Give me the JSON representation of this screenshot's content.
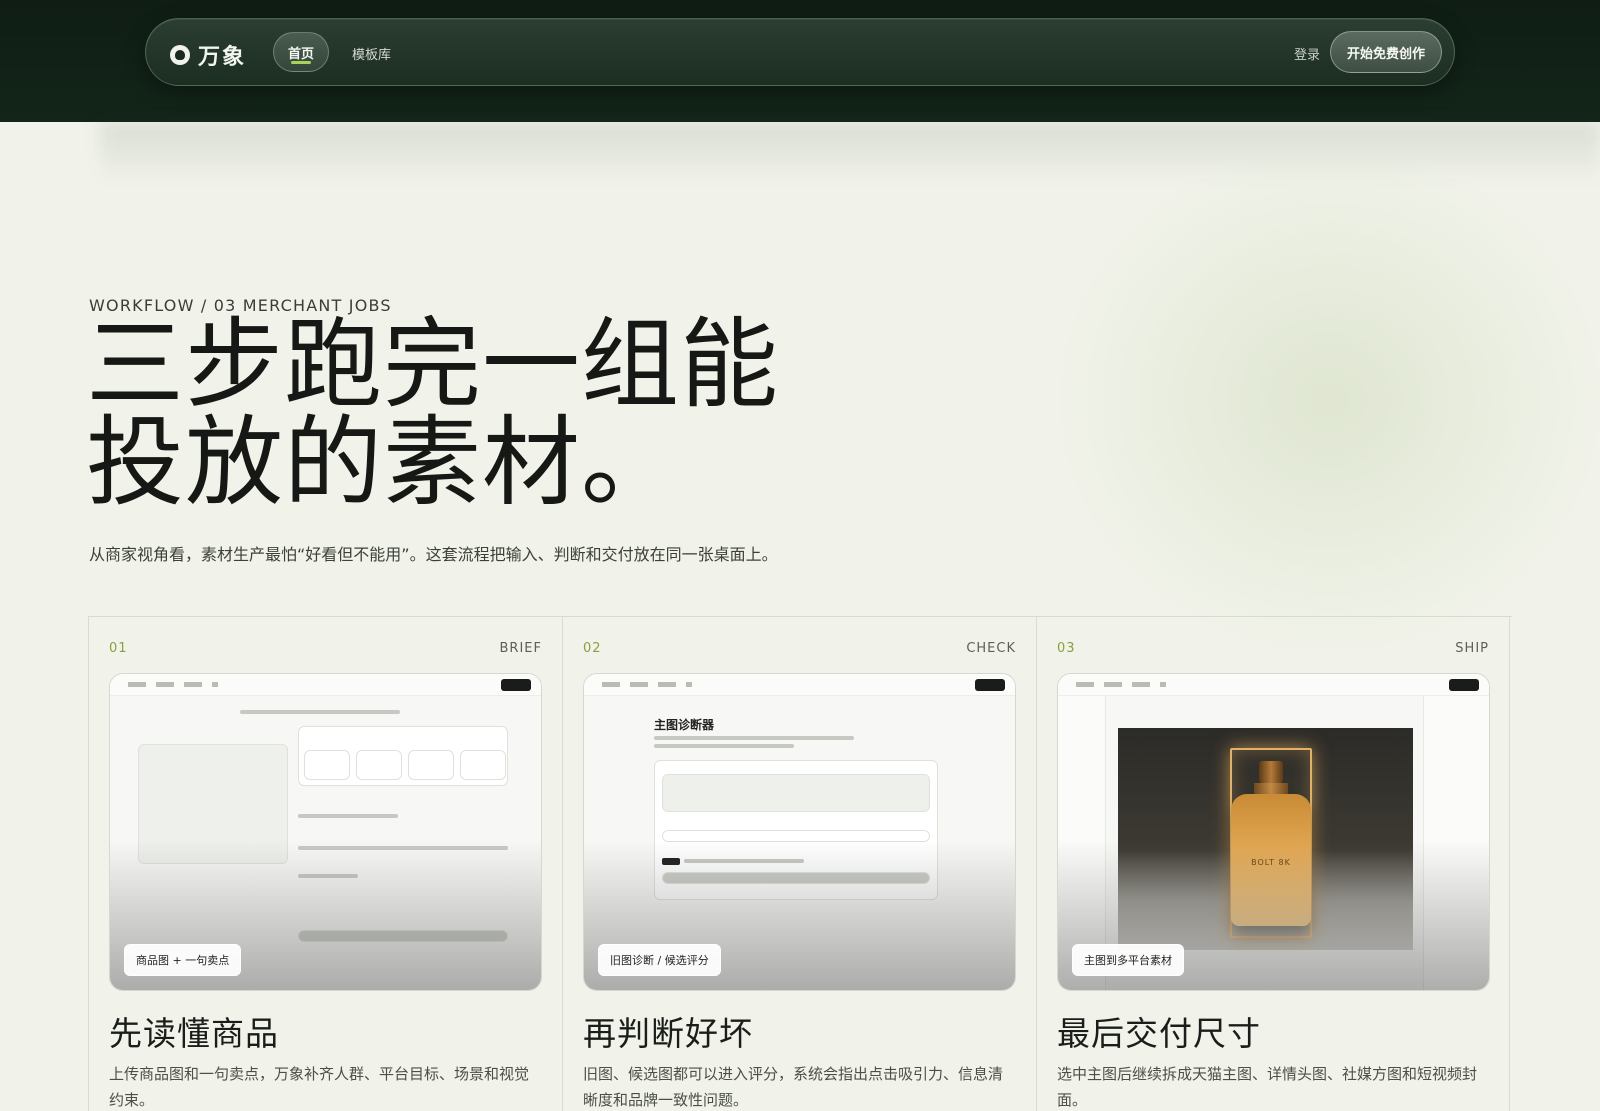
{
  "nav": {
    "logo_text": "万象",
    "home_label": "首页",
    "templates_label": "模板库",
    "login_label": "登录",
    "cta_label": "开始免费创作"
  },
  "hero": {
    "eyebrow": "WORKFLOW / 03 MERCHANT JOBS",
    "headline_line1": "三步跑完一组能",
    "headline_line2": "投放的素材。",
    "subtitle": "从商家视角看，素材生产最怕“好看但不能用”。这套流程把输入、判断和交付放在同一张桌面上。"
  },
  "cards": [
    {
      "num": "01",
      "tag": "BRIEF",
      "badge": "商品图 + 一句卖点",
      "title": "先读懂商品",
      "desc": "上传商品图和一句卖点，万象补齐人群、平台目标、场景和视觉约束。"
    },
    {
      "num": "02",
      "tag": "CHECK",
      "badge": "旧图诊断 / 候选评分",
      "title": "再判断好坏",
      "desc": "旧图、候选图都可以进入评分，系统会指出点击吸引力、信息清晰度和品牌一致性问题。",
      "mini_title": "主图诊断器"
    },
    {
      "num": "03",
      "tag": "SHIP",
      "badge": "主图到多平台素材",
      "title": "最后交付尺寸",
      "desc": "选中主图后继续拆成天猫主图、详情头图、社媒方图和短视频封面。",
      "product_label": "BOLT 8K"
    }
  ],
  "colors": {
    "band": "#0f1d15",
    "accent": "#a8d35a",
    "card_num": "#8aa040",
    "background": "#f1f3ea"
  }
}
